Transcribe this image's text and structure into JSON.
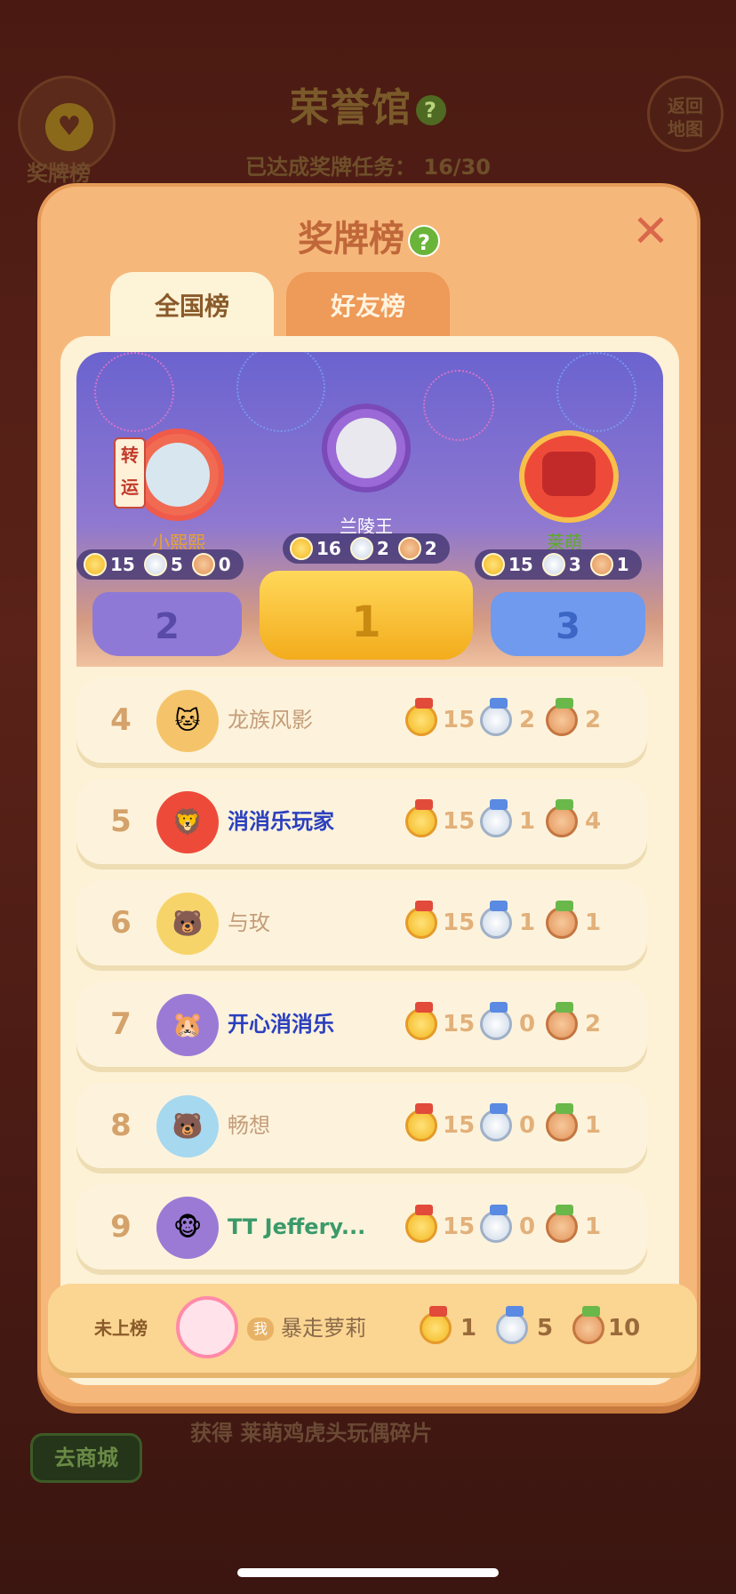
{
  "background": {
    "title": "荣誉馆",
    "help_icon": "?",
    "progress_label": "已达成奖牌任务：",
    "progress_value": "16/30",
    "left_button_label": "奖牌榜",
    "right_button_label_1": "返回",
    "right_button_label_2": "地图",
    "shop_button": "去商城",
    "bottom_text": "获得 莱萌鸡虎头玩偶碎片"
  },
  "modal": {
    "title": "奖牌榜",
    "help_icon": "?",
    "close_icon": "✕",
    "tabs": [
      {
        "label": "全国榜",
        "active": true
      },
      {
        "label": "好友榜",
        "active": false
      }
    ]
  },
  "podium": {
    "first": {
      "name": "兰陵王",
      "gold": "16",
      "silver": "2",
      "bronze": "2",
      "place": "1"
    },
    "second": {
      "name": "小熙熙",
      "gold": "15",
      "silver": "5",
      "bronze": "0",
      "place": "2",
      "badge": "转运"
    },
    "third": {
      "name": "莱萌",
      "gold": "15",
      "silver": "3",
      "bronze": "1",
      "place": "3"
    }
  },
  "rows": [
    {
      "rank": "4",
      "name": "龙族风影",
      "gold": "15",
      "silver": "2",
      "bronze": "2"
    },
    {
      "rank": "5",
      "name": "消消乐玩家",
      "gold": "15",
      "silver": "1",
      "bronze": "4"
    },
    {
      "rank": "6",
      "name": "与玫",
      "gold": "15",
      "silver": "1",
      "bronze": "1"
    },
    {
      "rank": "7",
      "name": "开心消消乐",
      "gold": "15",
      "silver": "0",
      "bronze": "2"
    },
    {
      "rank": "8",
      "name": "畅想",
      "gold": "15",
      "silver": "0",
      "bronze": "1"
    },
    {
      "rank": "9",
      "name": "TT Jeffery...",
      "gold": "15",
      "silver": "0",
      "bronze": "1"
    }
  ],
  "me": {
    "status": "未上榜",
    "badge": "我",
    "name": "暴走萝莉",
    "gold": "1",
    "silver": "5",
    "bronze": "10"
  },
  "colors": {
    "modal_bg": "#f6b87a",
    "panel_bg": "#fdf1d6",
    "title": "#c0673a",
    "rank": "#d4a26a",
    "name_blue": "#2a3fbf",
    "name_green": "#3aa84a"
  }
}
